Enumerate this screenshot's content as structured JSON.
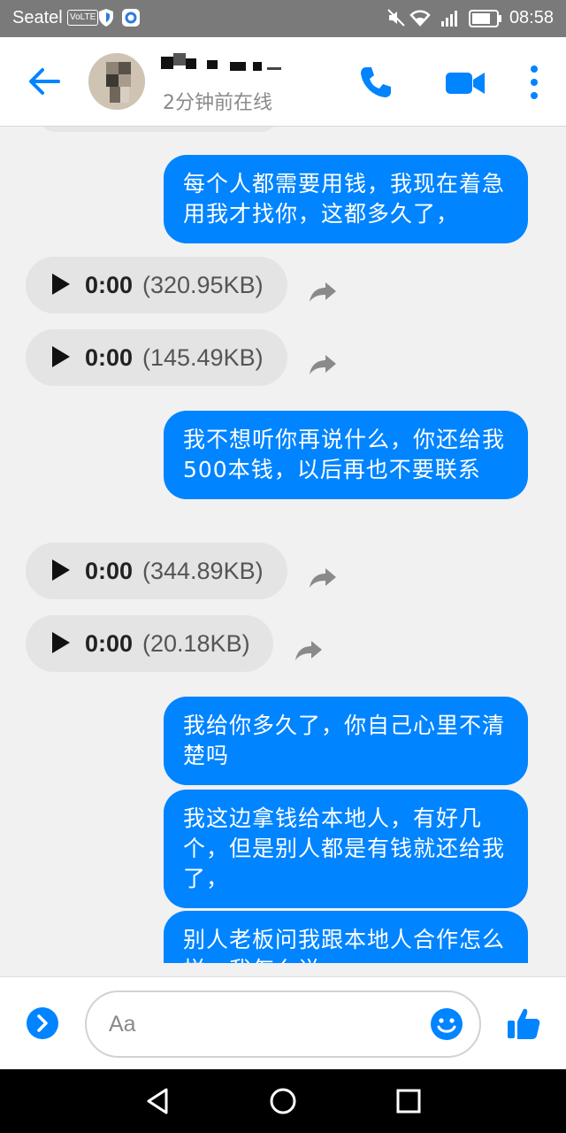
{
  "status_bar": {
    "carrier": "Seatel",
    "volte_badge": "VoLTE",
    "time": "08:58",
    "icons": [
      "shield-icon",
      "app-icon",
      "mute-icon",
      "wifi-icon",
      "signal-icon",
      "battery-icon"
    ]
  },
  "header": {
    "presence": "2分钟前在线",
    "icons": [
      "back-arrow-icon",
      "phone-icon",
      "video-camera-icon",
      "more-vertical-icon"
    ]
  },
  "messages": [
    {
      "kind": "outgoing",
      "text": "每个人都需要用钱，我现在着急用我才找你，这都多久了，"
    },
    {
      "kind": "audio",
      "duration": "0:00",
      "size": "(320.95KB)"
    },
    {
      "kind": "audio",
      "duration": "0:00",
      "size": "(145.49KB)"
    },
    {
      "kind": "outgoing",
      "text": "我不想听你再说什么，你还给我500本钱，以后再也不要联系"
    },
    {
      "kind": "audio",
      "duration": "0:00",
      "size": "(344.89KB)"
    },
    {
      "kind": "audio",
      "duration": "0:00",
      "size": "(20.18KB)"
    },
    {
      "kind": "outgoing",
      "text": "我给你多久了，你自己心里不清楚吗"
    },
    {
      "kind": "outgoing",
      "text": "我这边拿钱给本地人，有好几个，但是别人都是有钱就还给我了，"
    },
    {
      "kind": "outgoing",
      "text": "别人老板问我跟本地人合作怎么样，我怎么说"
    }
  ],
  "composer": {
    "placeholder": "Aa",
    "icons": [
      "expand-arrow-icon",
      "emoji-icon",
      "thumbs-up-icon"
    ]
  },
  "colors": {
    "accent": "#0084ff",
    "status_bar": "#7a7a7a",
    "audio_bubble": "#e4e4e4",
    "chat_bg": "#f1f1f1"
  }
}
